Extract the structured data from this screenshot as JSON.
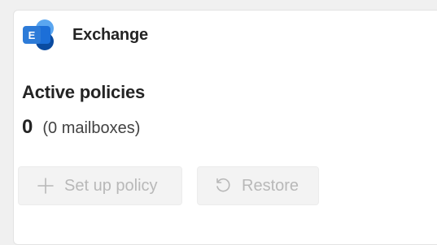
{
  "app": {
    "name": "Exchange",
    "logo_icon": "exchange-logo-icon",
    "logo_letter": "E",
    "colors": {
      "dark": "#0a4ba0",
      "mid": "#1c6fd8",
      "light": "#5aa6f0",
      "letter_tile": "#2d7bd8"
    }
  },
  "policies": {
    "title": "Active policies",
    "count": "0",
    "mailboxes": "(0 mailboxes)"
  },
  "actions": {
    "setup_label": "Set up policy",
    "setup_icon": "add-icon",
    "restore_label": "Restore",
    "restore_icon": "undo-icon",
    "disabled_color": "#b8b8b8"
  }
}
